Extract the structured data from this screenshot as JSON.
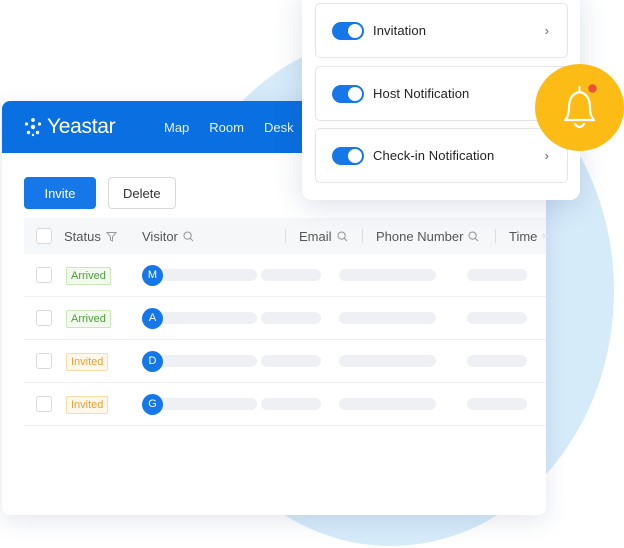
{
  "nav": {
    "brand": "Yeastar",
    "links": [
      "Map",
      "Room",
      "Desk"
    ]
  },
  "toolbar": {
    "invite_label": "Invite",
    "delete_label": "Delete"
  },
  "table": {
    "columns": [
      "Status",
      "Visitor",
      "Email",
      "Phone Number",
      "Time"
    ],
    "rows": [
      {
        "status": "Arrived",
        "initial": "M"
      },
      {
        "status": "Arrived",
        "initial": "A"
      },
      {
        "status": "Invited",
        "initial": "D"
      },
      {
        "status": "Invited",
        "initial": "G"
      }
    ]
  },
  "settings": {
    "items": [
      {
        "label": "Invitation",
        "enabled": true
      },
      {
        "label": "Host Notification",
        "enabled": true
      },
      {
        "label": "Check-in Notification",
        "enabled": true
      }
    ]
  },
  "colors": {
    "brand": "#0a6fe0",
    "accent": "#1677e8",
    "bell": "#fdbb16",
    "bell_dot": "#ea4e3d",
    "arrived": "#4d9d3a",
    "invited": "#e3a03b"
  },
  "icons": {
    "filter": "filter-icon",
    "search": "search-icon",
    "sort": "sort-icon",
    "chevron": "chevron-right-icon",
    "bell": "bell-icon"
  }
}
